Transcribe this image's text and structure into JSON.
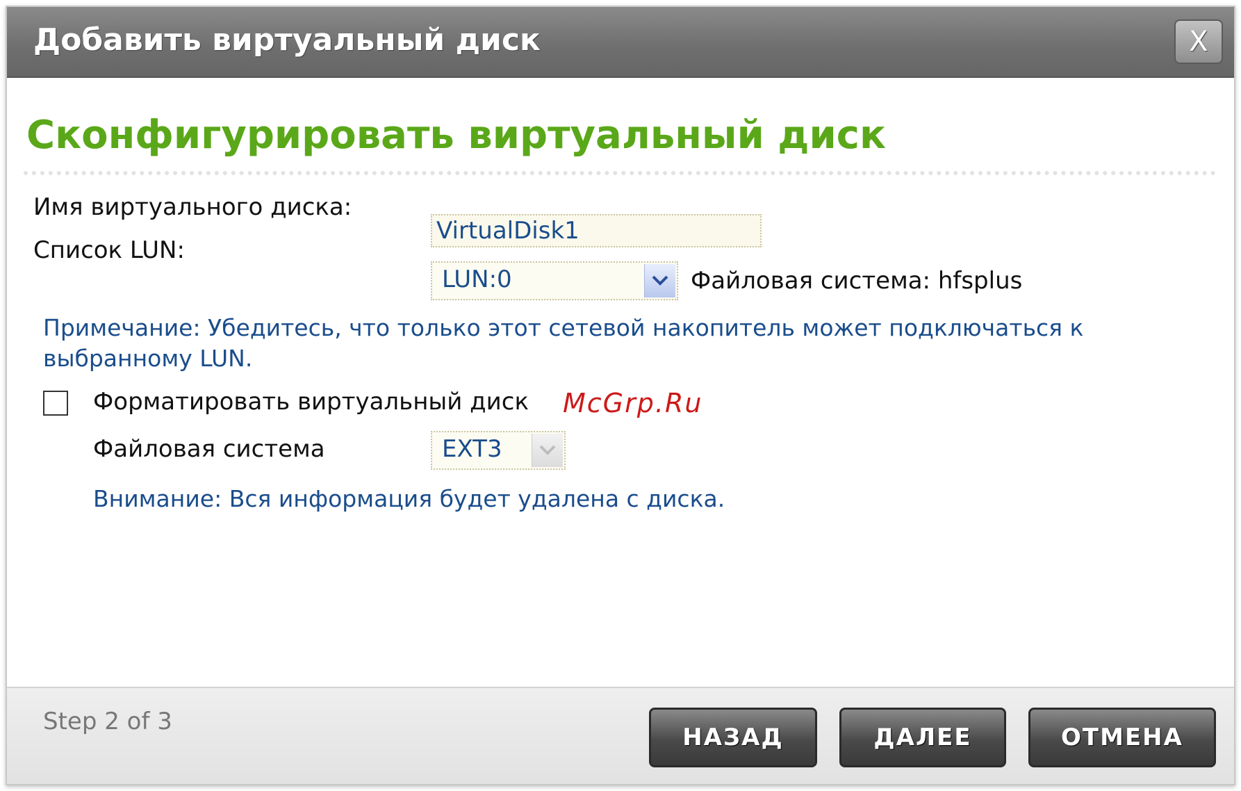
{
  "window": {
    "title": "Добавить виртуальный диск",
    "close_label": "X"
  },
  "page": {
    "heading": "Сконфигурировать виртуальный диск"
  },
  "form": {
    "disk_name_label": "Имя виртуального диска:",
    "disk_name_value": "VirtualDisk1",
    "lun_list_label": "Список LUN:",
    "lun_value": "LUN:0",
    "fs_info": "Файловая система: hfsplus",
    "note": "Примечание: Убедитесь, что только этот сетевой накопитель может подключаться к выбранному LUN.",
    "format_label": "Форматировать виртуальный диск",
    "format_checked": false,
    "fs_label": "Файловая система",
    "fs_value": "EXT3",
    "warning": "Внимание: Вся информация будет удалена с диска."
  },
  "watermark": "McGrp.Ru",
  "footer": {
    "step": "Step 2 of 3",
    "back": "НАЗАД",
    "next": "ДАЛЕЕ",
    "cancel": "ОТМЕНА"
  },
  "icons": {
    "dropdown": "chevron-down-icon",
    "close": "close-icon"
  },
  "colors": {
    "heading_green": "#5aa819",
    "link_blue": "#1a4d8c",
    "titlebar_gray": "#777777"
  }
}
